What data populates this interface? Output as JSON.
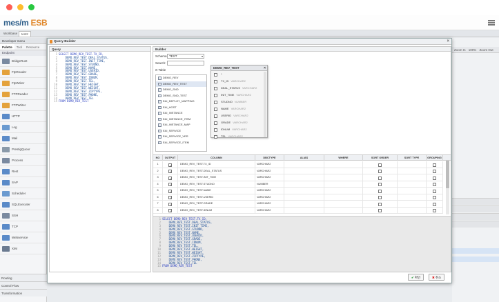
{
  "colors": {
    "close": "#fe5f57",
    "minimize": "#febc2e",
    "maximize": "#28c840",
    "accent": "#2f5f8a",
    "brand_orange": "#e0872a"
  },
  "app": {
    "logo_main": "mes/m",
    "logo_esb": "ESB",
    "tabs": [
      "Workbase",
      "test2"
    ]
  },
  "left_panel": {
    "title": "Developer menu",
    "tabs": [
      "Palette",
      "Tool",
      "Resource"
    ],
    "section": "Endpoint",
    "items": [
      {
        "label": "BridgeRunt",
        "icon": "bridge-icon"
      },
      {
        "label": "FtpReader",
        "icon": "folder-icon"
      },
      {
        "label": "FtpWriter",
        "icon": "folder-icon"
      },
      {
        "label": "FTPReader",
        "icon": "folder-icon"
      },
      {
        "label": "FTPWriter",
        "icon": "folder-icon"
      },
      {
        "label": "HTTP",
        "icon": "http-icon"
      },
      {
        "label": "Log",
        "icon": "log-icon"
      },
      {
        "label": "Mail",
        "icon": "mail-icon"
      },
      {
        "label": "PrestigQuour",
        "icon": "queue-icon"
      },
      {
        "label": "Process",
        "icon": "process-icon"
      },
      {
        "label": "Rest",
        "icon": "rest-icon"
      },
      {
        "label": "SAP",
        "icon": "sap-icon"
      },
      {
        "label": "Scheduler",
        "icon": "clock-icon"
      },
      {
        "label": "SQLExecuter",
        "icon": "database-icon"
      },
      {
        "label": "SSH",
        "icon": "terminal-icon"
      },
      {
        "label": "TCP",
        "icon": "network-icon"
      },
      {
        "label": "Webservice",
        "icon": "globe-icon"
      },
      {
        "label": "XIM",
        "icon": "xml-icon"
      }
    ],
    "bottom": [
      "Routing",
      "Control Flow",
      "Transformation"
    ]
  },
  "workspace": {
    "zoom_in": "Zoom In",
    "zoom_level": "100%",
    "zoom_out": "Zoom Out"
  },
  "dialog": {
    "title": "Query Builder",
    "query_label": "Query",
    "builder_label": "Builder",
    "schema_label": "Schema:",
    "schema_value": "TEST",
    "search_label": "Search:",
    "search_value": "",
    "table_label": "Table",
    "tables": [
      "DEMO_REV",
      "DEMO_REV_TEST",
      "DEMO_SND",
      "DEMO_SND_TEST",
      "EAI_DEPLOY_MAPPING",
      "EAI_HOST",
      "EAI_INSTANCE",
      "EAI_INSTANCE_ITEM",
      "EAI_INSTANCE_MAP",
      "EAI_SERVICE",
      "EAI_SERVICE_VER",
      "EAI_SERVICE_ITEM"
    ],
    "selected_table": 1,
    "entity": {
      "title": "DEMO_REV_TEST",
      "close": "×",
      "columns": [
        {
          "name": "*",
          "type": ""
        },
        {
          "name": "TX_ID",
          "type": "VARCHAR2"
        },
        {
          "name": "DEAL_STATUS",
          "type": "VARCHAR2"
        },
        {
          "name": "INIT_TIME",
          "type": "VARCHAR2"
        },
        {
          "name": "STUDNO",
          "type": "NUMBER"
        },
        {
          "name": "NAME",
          "type": "VARCHAR2"
        },
        {
          "name": "USERID",
          "type": "VARCHAR2"
        },
        {
          "name": "GRADE",
          "type": "VARCHAR2"
        },
        {
          "name": "IDNUM",
          "type": "VARCHAR2"
        },
        {
          "name": "TEL",
          "type": "VARCHAR2"
        }
      ]
    },
    "grid": {
      "headers": [
        "NO",
        "OUTPUT",
        "COLUMN",
        "DBCTYPE",
        "ALIAS",
        "WHERE",
        "SORT ORDER",
        "SORT TYPE",
        "GROUPING"
      ],
      "rows": [
        {
          "no": "1",
          "column": "DEMO_REV_TEST.TX_ID",
          "type": "VARCHAR2"
        },
        {
          "no": "2",
          "column": "DEMO_REV_TEST.DEAL_STATUS",
          "type": "VARCHAR2"
        },
        {
          "no": "3",
          "column": "DEMO_REV_TEST.INIT_TIME",
          "type": "VARCHAR2"
        },
        {
          "no": "4",
          "column": "DEMO_REV_TEST.STUDNO",
          "type": "NUMBER"
        },
        {
          "no": "5",
          "column": "DEMO_REV_TEST.NAME",
          "type": "VARCHAR2"
        },
        {
          "no": "6",
          "column": "DEMO_REV_TEST.USERID",
          "type": "VARCHAR2"
        },
        {
          "no": "7",
          "column": "DEMO_REV_TEST.GRADE",
          "type": "VARCHAR2"
        },
        {
          "no": "8",
          "column": "DEMO_REV_TEST.IDNUM",
          "type": "VARCHAR2"
        }
      ]
    },
    "query_lines": [
      "SELECT DEMO_REV_TEST.TX_ID,",
      "    DEMO_REV_TEST.DEAL_STATUS,",
      "    DEMO_REV_TEST.INIT_TIME,",
      "    DEMO_REV_TEST.STUDNO,",
      "    DEMO_REV_TEST.NAME,",
      "    DEMO_REV_TEST.USERID,",
      "    DEMO_REV_TEST.GRADE,",
      "    DEMO_REV_TEST.IDNUM,",
      "    DEMO_REV_TEST.TEL,",
      "    DEMO_REV_TEST.HEIGHT,",
      "    DEMO_REV_TEST.WEIGHT,",
      "    DEMO_REV_TEST.ZIPTYPE,",
      "    DEMO_REV_TEST.PHONE,",
      "    DEMO_REV_TEST.TEL",
      "FROM DEMO_REV_TEST"
    ],
    "sql_lines": [
      "SELECT DEMO_REV_TEST.TX_ID,",
      "    DEMO_REV_TEST.DEAL_STATUS,",
      "    DEMO_REV_TEST.INIT_TIME,",
      "    DEMO_REV_TEST.STUDNO,",
      "    DEMO_REV_TEST.NAME,",
      "    DEMO_REV_TEST.USERID,",
      "    DEMO_REV_TEST.GRADE,",
      "    DEMO_REV_TEST.IDNUM,",
      "    DEMO_REV_TEST.TEL,",
      "    DEMO_REV_TEST.HEIGHT,",
      "    DEMO_REV_TEST.WEIGHT,",
      "    DEMO_REV_TEST.ZIPTYPE,",
      "    DEMO_REV_TEST.PHONE,",
      "    DEMO_REV_TEST.TEL",
      "FROM DEMO_REV_TEST"
    ],
    "ok_label": "확인",
    "cancel_label": "취소"
  }
}
